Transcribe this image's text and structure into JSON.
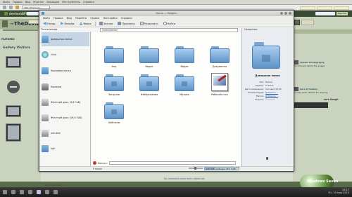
{
  "browser": {
    "menu": [
      "Файл",
      "Правка",
      "Вид",
      "Журнал",
      "Закладки",
      "Инструменты",
      "Справка"
    ],
    "url": "http://thedevia...",
    "right_tabs": [
      "",
      "",
      ""
    ]
  },
  "deviantart": {
    "logo": "deviantART",
    "profile_title": "~TheDevia",
    "profile_sub": "",
    "nav": "FEATURED",
    "gallery_label": "Gallery Visitors",
    "right_button": "Take the Tour",
    "commenter": "sara Gough",
    "no_comments": "No comments have been visited yet",
    "add_comment": "Add a Comment:",
    "comments": [
      {
        "name": "Visions Photography",
        "text": "A comment about the image"
      },
      {
        "name": "Sara of Gallery",
        "text": "Lovely work, thanks for sharing"
      },
      {
        "name": "",
        "text": ""
      }
    ]
  },
  "dolphin": {
    "title": "Home — Dolphin",
    "menu": [
      "Файл",
      "Правка",
      "Вид",
      "Перейти",
      "Сервис",
      "Настройка",
      "Справка"
    ],
    "toolbar": {
      "back": "Назад",
      "forward": "Вперёд",
      "up": "Вверх",
      "view": "Значки",
      "preview": "Просмотр",
      "split": "Разделить",
      "find": "Найти"
    },
    "places_title": "Точки входа",
    "places": [
      {
        "label": "Домашняя папка",
        "icon": "home-folder-icon",
        "selected": true
      },
      {
        "label": "Сеть",
        "icon": "network-icon",
        "selected": false
      },
      {
        "label": "Корневая папка",
        "icon": "root-folder-icon",
        "selected": false
      },
      {
        "label": "Корзина",
        "icon": "trash-icon",
        "selected": false
      },
      {
        "label": "Жесткий диск (9,6 ГиБ)",
        "icon": "hard-drive-icon",
        "selected": false
      },
      {
        "label": "Жесткий диск (19,6 ГиБ)",
        "icon": "hard-drive-icon",
        "selected": false
      },
      {
        "label": "win-disk",
        "icon": "hard-drive-icon",
        "selected": false
      },
      {
        "label": "tyjh",
        "icon": "folder-icon",
        "selected": false
      }
    ],
    "breadcrumb": "/home/darker/",
    "items": [
      {
        "label": "tmp",
        "type": "folder"
      },
      {
        "label": "Видео",
        "type": "folder"
      },
      {
        "label": "Видео",
        "type": "folder"
      },
      {
        "label": "Документы",
        "type": "folder"
      },
      {
        "label": "Загрузки",
        "type": "folder"
      },
      {
        "label": "Изображения",
        "type": "folder"
      },
      {
        "label": "Музыка",
        "type": "folder"
      },
      {
        "label": "Рабочий стол",
        "type": "pdf"
      },
      {
        "label": "Шаблоны",
        "type": "folder"
      }
    ],
    "info": {
      "title": "Сведения",
      "name": "Домашняя папка",
      "rows": [
        {
          "key": "Тип:",
          "value": "Папка",
          "link": false
        },
        {
          "key": "Размер:",
          "value": "9 Элем.",
          "link": false
        },
        {
          "key": "Дата изменения:",
          "value": "Сегодня 19:02",
          "link": false
        },
        {
          "key": "Комментарий:",
          "value": "Добавить...",
          "link": true
        },
        {
          "key": "Метки:",
          "value": "Добавить...",
          "link": true
        },
        {
          "key": "Оценка:",
          "value": "☆☆☆☆☆",
          "link": false
        }
      ]
    },
    "filter_label": "Фильтр:",
    "status": "9 папок",
    "free_space": "2,6 ГиБ свободно (8,4 ГиБ)",
    "free_fraction": 0.3
  },
  "taskbar": {
    "clock": "19:17",
    "date": "Пт, 19 мар 2010",
    "logo_text": "Windows Seven"
  }
}
